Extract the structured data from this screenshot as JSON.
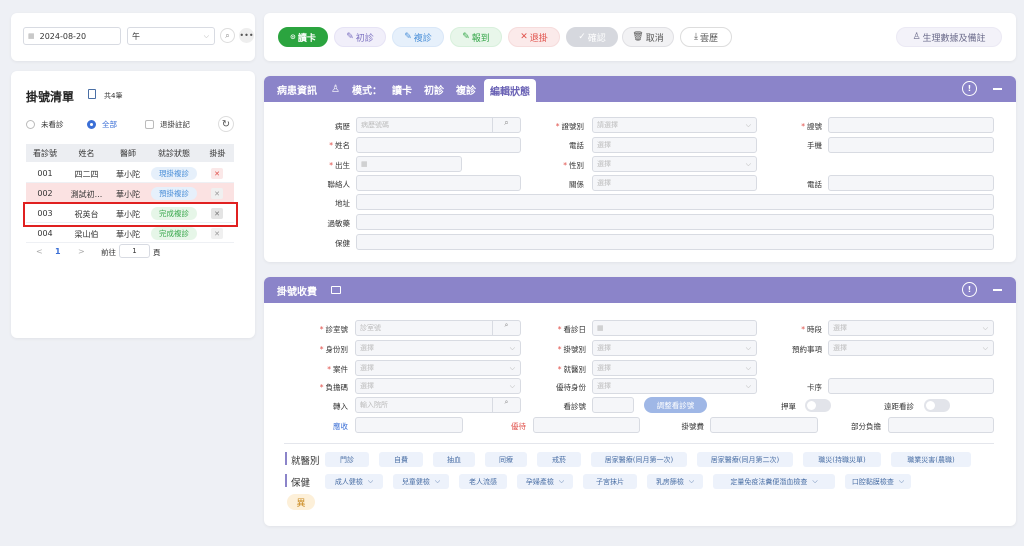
{
  "top": {
    "date": "2024-08-20",
    "period": "午"
  },
  "toolbar": {
    "read_card": "讀卡",
    "first": "初診",
    "repeat": "複診",
    "report": "報到",
    "withdraw": "退掛",
    "confirm": "確認",
    "cancel": "取消",
    "cloud": "雲歷",
    "vitals": "生理數據及備註"
  },
  "list": {
    "title": "掛號清單",
    "count": "共4筆",
    "filters": [
      "未看診",
      "全部",
      "退掛註記"
    ],
    "headers": [
      "看診號",
      "姓名",
      "醫師",
      "就診狀態",
      "掛掛"
    ],
    "rows": [
      {
        "no": "001",
        "name": "四二四",
        "doctor": "華小陀",
        "status": "現掛複診",
        "status_color": "#4a8fd8",
        "status_bg": "#e6f0fb",
        "x_color": "#e0504a",
        "x_bg": "#fbe8e8"
      },
      {
        "no": "002",
        "name": "測試初...",
        "doctor": "華小陀",
        "status": "預掛複診",
        "status_color": "#4a8fd8",
        "status_bg": "#e6f0fb",
        "x_color": "#999",
        "x_bg": "#f0f0f0"
      },
      {
        "no": "003",
        "name": "祝英台",
        "doctor": "華小陀",
        "status": "完成複診",
        "status_color": "#38a84c",
        "status_bg": "#e6f6e8",
        "x_color": "#777",
        "x_bg": "#e4e4e4"
      },
      {
        "no": "004",
        "name": "梁山伯",
        "doctor": "華小陀",
        "status": "完成複診",
        "status_color": "#38a84c",
        "status_bg": "#e6f6e8",
        "x_color": "#999",
        "x_bg": "#f0f0f0"
      }
    ],
    "pager": {
      "prev": "<",
      "page": "1",
      "next": ">",
      "goto": "前往",
      "page_val": "1",
      "unit": "頁"
    }
  },
  "patient": {
    "title": "病患資訊",
    "mode": "模式：",
    "tabs": [
      "讀卡",
      "初診",
      "複診",
      "編輯狀態"
    ],
    "f": {
      "record": "病歷",
      "record_ph": "病歷號碼",
      "idtype": "證號別",
      "idtype_ph": "請選擇",
      "idno": "證號",
      "name": "姓名",
      "phone": "電話",
      "phone_ph": "選擇",
      "mobile": "手機",
      "birth": "出生",
      "gender": "性別",
      "gender_ph": "選擇",
      "contact": "聯絡人",
      "relation": "關係",
      "relation_ph": "選擇",
      "phone2": "電話",
      "address": "地址",
      "allergy": "過敏藥",
      "insurance": "保健"
    }
  },
  "reg": {
    "title": "掛號收費",
    "f": {
      "room": "診室號",
      "room_ph": "診室號",
      "date": "看診日",
      "slot": "時段",
      "slot_ph": "選擇",
      "identity": "身份別",
      "identity_ph": "選擇",
      "regtype": "掛號別",
      "regtype_ph": "選擇",
      "booking": "預約事項",
      "booking_ph": "選擇",
      "case": "案件",
      "case_ph": "選擇",
      "medtype": "就醫別",
      "medtype_ph": "選擇",
      "copay": "負擔碼",
      "copay_ph": "選擇",
      "discount": "優待身份",
      "discount_ph": "選擇",
      "cardseq": "卡序",
      "transfer": "轉入",
      "transfer_ph": "輸入院所",
      "visitno": "看診號",
      "adjust": "調整看診號",
      "deposit": "押單",
      "remote": "遠距看診",
      "collect": "應收",
      "offer": "優待",
      "regfee": "掛號費",
      "partial": "部分負擔"
    },
    "medtags_label": "就醫別",
    "medtags": [
      "門診",
      "自費",
      "抽血",
      "同療",
      "戒菸",
      "居家醫療(同月第一次)",
      "居家醫療(同月第二次)",
      "職災(持職災單)",
      "職業災害(農職)"
    ],
    "healthtags_label": "保健",
    "healthtags": [
      "成人健檢",
      "兒童健檢",
      "老人流感",
      "孕婦產檢",
      "子宮抹片",
      "乳房篩檢",
      "定量免疫法糞便潛血檢查",
      "口腔黏膜檢查"
    ],
    "abnormal": "異"
  },
  "colors": {
    "header": "#8b84c9",
    "accent": "#3b6fd6",
    "highlight": "#e02020",
    "green": "#27a33a"
  }
}
